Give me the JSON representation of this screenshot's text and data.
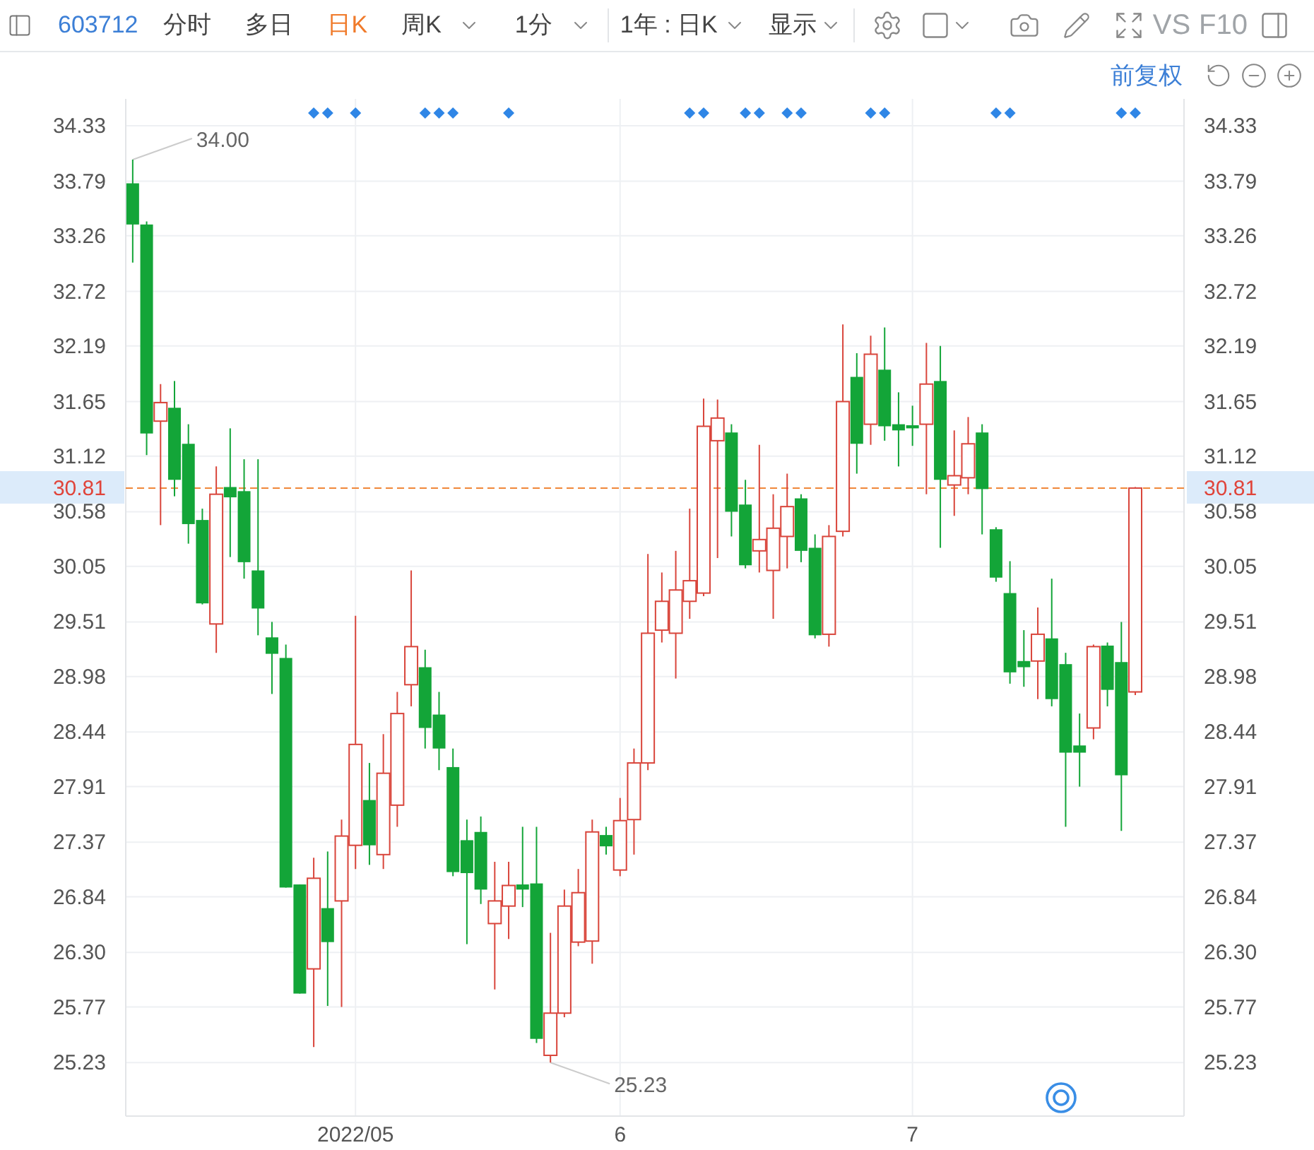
{
  "toolbar": {
    "code": "603712",
    "tabs": [
      {
        "label": "分时",
        "selected": false,
        "kind": "tab"
      },
      {
        "label": "多日",
        "selected": false,
        "kind": "tab"
      },
      {
        "label": "日K",
        "selected": true,
        "kind": "tab"
      },
      {
        "label": "周K",
        "selected": false,
        "kind": "menu"
      },
      {
        "label": "1分",
        "selected": false,
        "kind": "menu"
      }
    ],
    "range_menu": "1年 : 日K",
    "display_menu": "显示",
    "text_buttons": [
      "VS",
      "F10"
    ]
  },
  "adjust_link": "前复权",
  "chart": {
    "event_markers": [
      false,
      false,
      false,
      false,
      false,
      false,
      false,
      false,
      false,
      false,
      false,
      false,
      false,
      true,
      true,
      false,
      true,
      false,
      false,
      false,
      false,
      true,
      true,
      true,
      false,
      false,
      false,
      true,
      false,
      false,
      false,
      false,
      false,
      false,
      false,
      false,
      false,
      false,
      false,
      false,
      true,
      true,
      false,
      false,
      true,
      true,
      false,
      true,
      true,
      false,
      false,
      false,
      false,
      true,
      true,
      false,
      false,
      false,
      false,
      false,
      false,
      false,
      true,
      true,
      false,
      false,
      false,
      false,
      false,
      false,
      false,
      true,
      true
    ],
    "chart_data": {
      "type": "candlestick",
      "grid": true,
      "ylim": [
        24.71,
        34.59
      ],
      "y2lim": [
        24.71,
        34.59
      ],
      "categories": [
        null,
        null,
        null,
        null,
        null,
        null,
        null,
        null,
        null,
        null,
        null,
        null,
        null,
        null,
        null,
        null,
        "2022/05",
        null,
        null,
        null,
        null,
        null,
        null,
        null,
        null,
        null,
        null,
        null,
        null,
        null,
        null,
        null,
        null,
        null,
        null,
        "6",
        null,
        null,
        null,
        null,
        null,
        null,
        null,
        null,
        null,
        null,
        null,
        null,
        null,
        null,
        null,
        null,
        null,
        null,
        null,
        null,
        "7",
        null,
        null,
        null,
        null,
        null,
        null,
        null,
        null,
        null,
        null,
        null,
        null,
        null,
        null,
        null,
        null,
        null,
        null,
        null
      ],
      "yticks": [
        34.33,
        33.79,
        33.26,
        32.72,
        32.19,
        31.65,
        31.12,
        {
          "value": 30.81,
          "label": "30.81"
        },
        30.58,
        30.05,
        29.51,
        28.98,
        28.44,
        27.91,
        27.37,
        26.84,
        {
          "value": 26.3,
          "label": "26.30"
        },
        25.77,
        25.23
      ],
      "y2ticks": [
        34.33,
        33.79,
        33.26,
        32.72,
        32.19,
        31.65,
        31.12,
        30.58,
        30.05,
        29.51,
        28.98,
        28.44,
        27.91,
        27.37,
        26.84,
        {
          "value": 26.3,
          "label": "26.30"
        },
        25.77,
        25.23
      ],
      "ohlc": [
        [
          33.77,
          34.0,
          33.0,
          33.37
        ],
        [
          33.37,
          33.4,
          31.13,
          31.34
        ],
        [
          31.46,
          31.82,
          30.45,
          31.64
        ],
        [
          31.59,
          31.85,
          30.73,
          30.89
        ],
        [
          31.24,
          31.43,
          30.27,
          30.46
        ],
        [
          30.5,
          30.61,
          29.68,
          29.69
        ],
        [
          29.49,
          31.02,
          29.21,
          30.75
        ],
        [
          30.82,
          31.39,
          30.14,
          30.72
        ],
        [
          30.78,
          31.09,
          29.93,
          30.09
        ],
        [
          30.01,
          31.09,
          29.38,
          29.64
        ],
        [
          29.36,
          29.51,
          28.81,
          29.2
        ],
        [
          29.16,
          29.29,
          26.93,
          26.93
        ],
        [
          26.96,
          26.96,
          25.9,
          25.9
        ],
        [
          26.14,
          27.22,
          25.38,
          27.02
        ],
        [
          26.73,
          27.28,
          25.78,
          26.4
        ],
        [
          26.8,
          27.59,
          25.77,
          27.43
        ],
        [
          27.34,
          29.57,
          27.11,
          28.32
        ],
        [
          27.78,
          28.14,
          27.15,
          27.34
        ],
        [
          27.25,
          28.42,
          27.11,
          28.04
        ],
        [
          27.73,
          28.83,
          27.52,
          28.62
        ],
        [
          28.9,
          30.01,
          28.69,
          29.27
        ],
        [
          29.07,
          29.24,
          28.28,
          28.48
        ],
        [
          28.61,
          28.83,
          28.07,
          28.28
        ],
        [
          28.1,
          28.28,
          27.04,
          27.08
        ],
        [
          27.39,
          27.59,
          26.38,
          27.07
        ],
        [
          27.47,
          27.62,
          26.77,
          26.91
        ],
        [
          26.58,
          27.18,
          25.94,
          26.8
        ],
        [
          26.75,
          27.18,
          26.43,
          26.95
        ],
        [
          26.96,
          27.52,
          26.74,
          26.91
        ],
        [
          26.97,
          27.52,
          25.42,
          25.46
        ],
        [
          25.3,
          26.49,
          25.23,
          25.71
        ],
        [
          25.71,
          26.91,
          25.67,
          26.75
        ],
        [
          26.4,
          27.11,
          26.36,
          26.88
        ],
        [
          26.41,
          27.59,
          26.19,
          27.47
        ],
        [
          27.44,
          27.52,
          27.25,
          27.33
        ],
        [
          27.1,
          27.8,
          27.04,
          27.58
        ],
        [
          27.59,
          28.28,
          27.25,
          28.14
        ],
        [
          28.14,
          30.17,
          28.07,
          29.4
        ],
        [
          29.43,
          29.99,
          29.31,
          29.71
        ],
        [
          29.4,
          30.2,
          28.96,
          29.82
        ],
        [
          29.71,
          30.61,
          29.54,
          29.91
        ],
        [
          29.79,
          31.68,
          29.76,
          31.41
        ],
        [
          31.27,
          31.67,
          30.13,
          31.49
        ],
        [
          31.35,
          31.43,
          30.34,
          30.58
        ],
        [
          30.65,
          30.89,
          30.03,
          30.06
        ],
        [
          30.2,
          31.23,
          29.99,
          30.31
        ],
        [
          30.01,
          30.75,
          29.54,
          30.42
        ],
        [
          30.34,
          30.95,
          30.03,
          30.63
        ],
        [
          30.71,
          30.75,
          30.09,
          30.2
        ],
        [
          30.23,
          30.36,
          29.35,
          29.38
        ],
        [
          29.39,
          30.45,
          29.27,
          30.34
        ],
        [
          30.39,
          32.4,
          30.34,
          31.65
        ],
        [
          31.89,
          32.12,
          30.95,
          31.24
        ],
        [
          31.43,
          32.29,
          31.23,
          32.11
        ],
        [
          31.96,
          32.37,
          31.27,
          31.41
        ],
        [
          31.43,
          31.74,
          31.02,
          31.37
        ],
        [
          31.42,
          31.61,
          31.22,
          31.39
        ],
        [
          31.43,
          32.22,
          30.75,
          31.82
        ],
        [
          31.85,
          32.19,
          30.23,
          30.89
        ],
        [
          30.84,
          31.37,
          30.54,
          30.93
        ],
        [
          30.91,
          31.5,
          30.75,
          31.24
        ],
        [
          31.35,
          31.43,
          30.36,
          30.8
        ],
        [
          30.41,
          30.43,
          29.9,
          29.94
        ],
        [
          29.79,
          30.1,
          28.91,
          29.02
        ],
        [
          29.13,
          29.43,
          28.88,
          29.07
        ],
        [
          29.13,
          29.65,
          28.76,
          29.39
        ],
        [
          29.35,
          29.93,
          28.69,
          28.76
        ],
        [
          29.1,
          29.21,
          27.52,
          28.24
        ],
        [
          28.31,
          28.62,
          27.91,
          28.24
        ],
        [
          28.48,
          29.29,
          28.37,
          29.27
        ],
        [
          29.28,
          29.31,
          28.69,
          28.85
        ],
        [
          29.12,
          29.51,
          27.48,
          28.02
        ],
        [
          28.83,
          30.82,
          28.8,
          30.81
        ],
        null,
        null,
        null
      ],
      "ref_lines": [
        {
          "axis": "y",
          "value": 30.81,
          "color": "#f0883a",
          "label": "30.81"
        }
      ],
      "annotations": [
        "34.00",
        "25.23"
      ]
    }
  }
}
